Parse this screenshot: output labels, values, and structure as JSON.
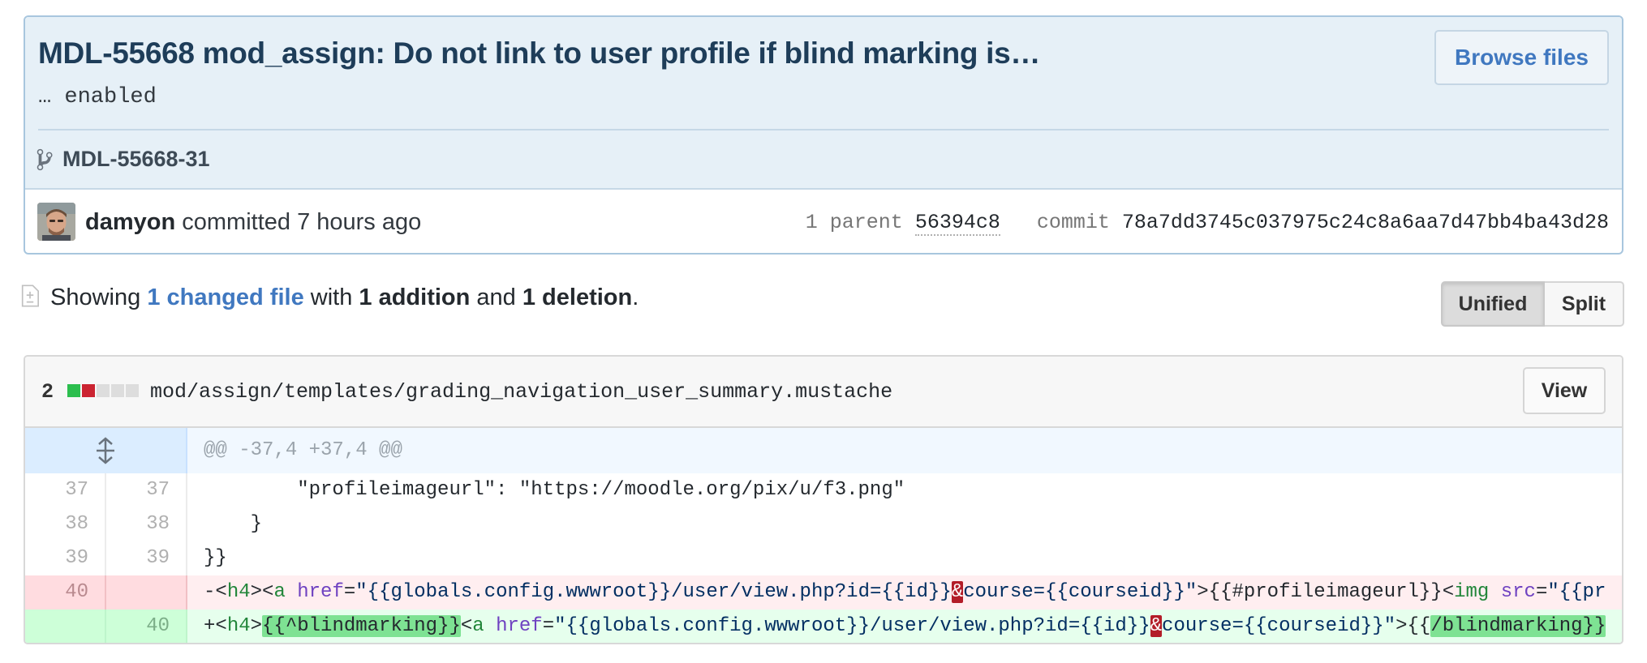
{
  "commit": {
    "title": "MDL-55668 mod_assign: Do not link to user profile if blind marking is…",
    "description": "… enabled",
    "branch": "MDL-55668-31",
    "browse_label": "Browse files",
    "author": "damyon",
    "committed_text": "committed 7 hours ago",
    "parent_label": "1 parent",
    "parent_sha": "56394c8",
    "commit_label": "commit",
    "commit_sha": "78a7dd3745c037975c24c8a6aa7d47bb4ba43d28"
  },
  "summary": {
    "showing": "Showing",
    "changed_files": "1 changed file",
    "with": "with",
    "additions": "1 addition",
    "and": "and",
    "deletions": "1 deletion",
    "period": "."
  },
  "view_toggle": {
    "unified_label": "Unified",
    "split_label": "Split",
    "selected": "Unified"
  },
  "file": {
    "changes": "2",
    "path": "mod/assign/templates/grading_navigation_user_summary.mustache",
    "view_label": "View",
    "diffstat": [
      "added",
      "deleted",
      "neutral",
      "neutral",
      "neutral"
    ],
    "hunk_header": "@@ -37,4 +37,4 @@",
    "lines": [
      {
        "old": "37",
        "new": "37",
        "type": "context",
        "text": "        \"profileimageurl\": \"https://moodle.org/pix/u/f3.png\""
      },
      {
        "old": "38",
        "new": "38",
        "type": "context",
        "text": "    }"
      },
      {
        "old": "39",
        "new": "39",
        "type": "context",
        "text": "}}"
      }
    ],
    "deleted_line": {
      "old": "40",
      "prefix": "-",
      "p1": "<",
      "tag1": "h4",
      "p2": "><",
      "tag2": "a",
      "attr1": " href",
      "p3": "=",
      "str1": "\"{{globals.config.wwwroot}}/user/view.php?id={{id}}",
      "amp": "&",
      "str2": "course={{courseid}}\"",
      "p4": ">{{#profileimageurl}}<",
      "tag3": "img",
      "attr2": " src",
      "p5": "=",
      "str3": "\"{{pr"
    },
    "added_line": {
      "new": "40",
      "prefix": "+",
      "p1": "<",
      "tag1": "h4",
      "p2": ">",
      "hl1": "{{^blindmarking}}",
      "p3": "<",
      "tag2": "a",
      "attr1": " href",
      "p4": "=",
      "str1": "\"{{globals.config.wwwroot}}/user/view.php?id={{id}}",
      "amp": "&",
      "str2": "course={{courseid}}\"",
      "p5": ">{{",
      "hl2": "/blindmarking}}"
    }
  },
  "colors": {
    "link": "#4078c0",
    "header_bg": "#e6f0f7",
    "deleted_bg": "#ffeef0",
    "added_bg": "#e6ffed"
  },
  "icons": [
    "branch-icon",
    "file-diff-icon",
    "expand-icon"
  ]
}
